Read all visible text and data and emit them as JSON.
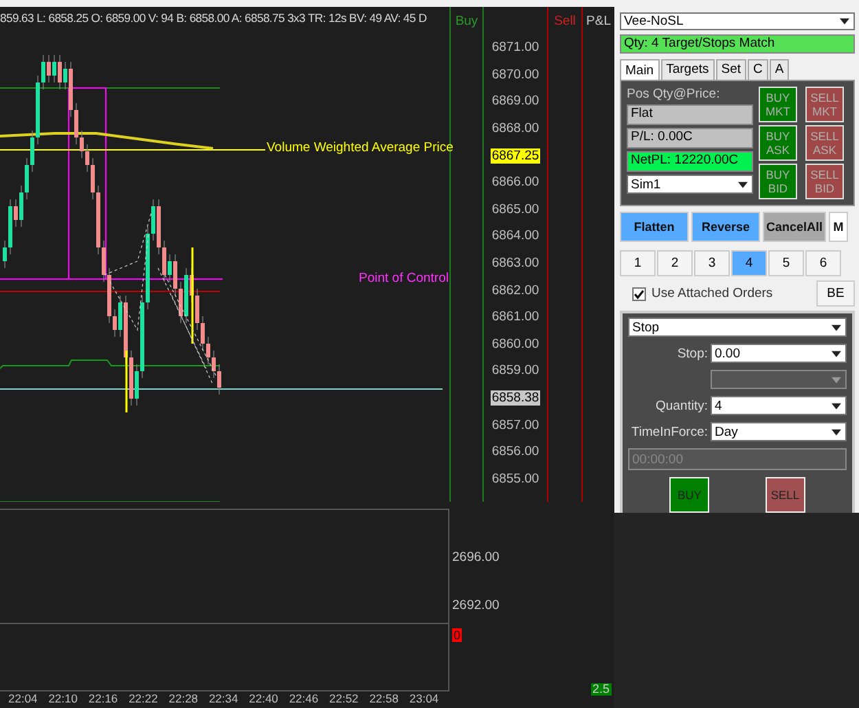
{
  "chart": {
    "header": "859.63 L: 6858.25 O: 6859.00 V: 94 B: 6858.00 A: 6858.75 3x3 TR: 12s BV: 49 AV: 45 D",
    "vwap_label": "Volume Weighted Average Price",
    "poc_label": "Point of Control",
    "time_labels": [
      "22:04",
      "22:10",
      "22:16",
      "22:22",
      "22:28",
      "22:34",
      "22:40",
      "22:46",
      "22:52",
      "22:58",
      "23:04"
    ]
  },
  "ladder": {
    "columns": [
      {
        "label": "Buy",
        "kind": "buy"
      },
      {
        "label": "Sell",
        "kind": "sell"
      },
      {
        "label": "P&L",
        "kind": "pnl"
      }
    ],
    "prices": [
      {
        "text": "6871.00",
        "kind": "tick"
      },
      {
        "text": "6870.00",
        "kind": "tick"
      },
      {
        "text": "6869.00",
        "kind": "tick"
      },
      {
        "text": "6868.00",
        "kind": "tick"
      },
      {
        "text": "6867.25",
        "kind": "last"
      },
      {
        "text": "6866.00",
        "kind": "tick"
      },
      {
        "text": "6865.00",
        "kind": "tick"
      },
      {
        "text": "6864.00",
        "kind": "tick"
      },
      {
        "text": "6863.00",
        "kind": "tick"
      },
      {
        "text": "6862.00",
        "kind": "tick"
      },
      {
        "text": "6861.00",
        "kind": "tick"
      },
      {
        "text": "6860.00",
        "kind": "tick"
      },
      {
        "text": "6859.00",
        "kind": "tick"
      },
      {
        "text": "6858.38",
        "kind": "marker"
      },
      {
        "text": "6857.00",
        "kind": "tick"
      },
      {
        "text": "6856.00",
        "kind": "tick"
      },
      {
        "text": "6855.00",
        "kind": "tick"
      }
    ]
  },
  "lower_axis": {
    "ticks": [
      "2696.00",
      "2692.00"
    ],
    "badges": [
      {
        "text": "0",
        "color": "#ff0000"
      },
      {
        "text": "2.5",
        "color": "#008000"
      }
    ]
  },
  "panel": {
    "strategy": "Vee-NoSL",
    "status": "Qty: 4 Target/Stops Match",
    "tabs": [
      {
        "label": "Main",
        "selected": true
      },
      {
        "label": "Targets",
        "selected": false
      },
      {
        "label": "Set",
        "selected": false
      },
      {
        "label": "C",
        "selected": false
      },
      {
        "label": "A",
        "selected": false
      }
    ],
    "pos_label": "Pos Qty@Price:",
    "position": "Flat",
    "pl": "P/L: 0.00C",
    "net_pl": "NetPL: 12220.00C",
    "account": "Sim1",
    "order_buttons": [
      {
        "label": "BUY MKT",
        "kind": "buy"
      },
      {
        "label": "SELL MKT",
        "kind": "sell"
      },
      {
        "label": "BUY ASK",
        "kind": "buy"
      },
      {
        "label": "SELL ASK",
        "kind": "sell"
      },
      {
        "label": "BUY BID",
        "kind": "buy"
      },
      {
        "label": "SELL BID",
        "kind": "sell"
      }
    ],
    "actions": [
      {
        "label": "Flatten",
        "kind": "primary"
      },
      {
        "label": "Reverse",
        "kind": "primary"
      },
      {
        "label": "CancelAll",
        "kind": "secondary"
      },
      {
        "label": "M",
        "kind": "plain"
      }
    ],
    "quantities": [
      {
        "label": "1",
        "selected": false
      },
      {
        "label": "2",
        "selected": false
      },
      {
        "label": "3",
        "selected": false
      },
      {
        "label": "4",
        "selected": true
      },
      {
        "label": "5",
        "selected": false
      },
      {
        "label": "6",
        "selected": false
      }
    ],
    "attached": {
      "label": "Use Attached Orders",
      "checked": true
    },
    "be": "BE",
    "order": {
      "type": "Stop",
      "fields": [
        {
          "label": "Stop:",
          "value": "0.00",
          "disabled": false
        },
        {
          "disabled": true
        },
        {
          "label": "Quantity:",
          "value": "4",
          "disabled": false
        },
        {
          "label": "TimeInForce:",
          "value": "Day",
          "disabled": false
        }
      ],
      "time_placeholder": "00:00:00",
      "buttons": [
        {
          "label": "BUY",
          "kind": "buy"
        },
        {
          "label": "SELL",
          "kind": "sell"
        }
      ]
    }
  }
}
